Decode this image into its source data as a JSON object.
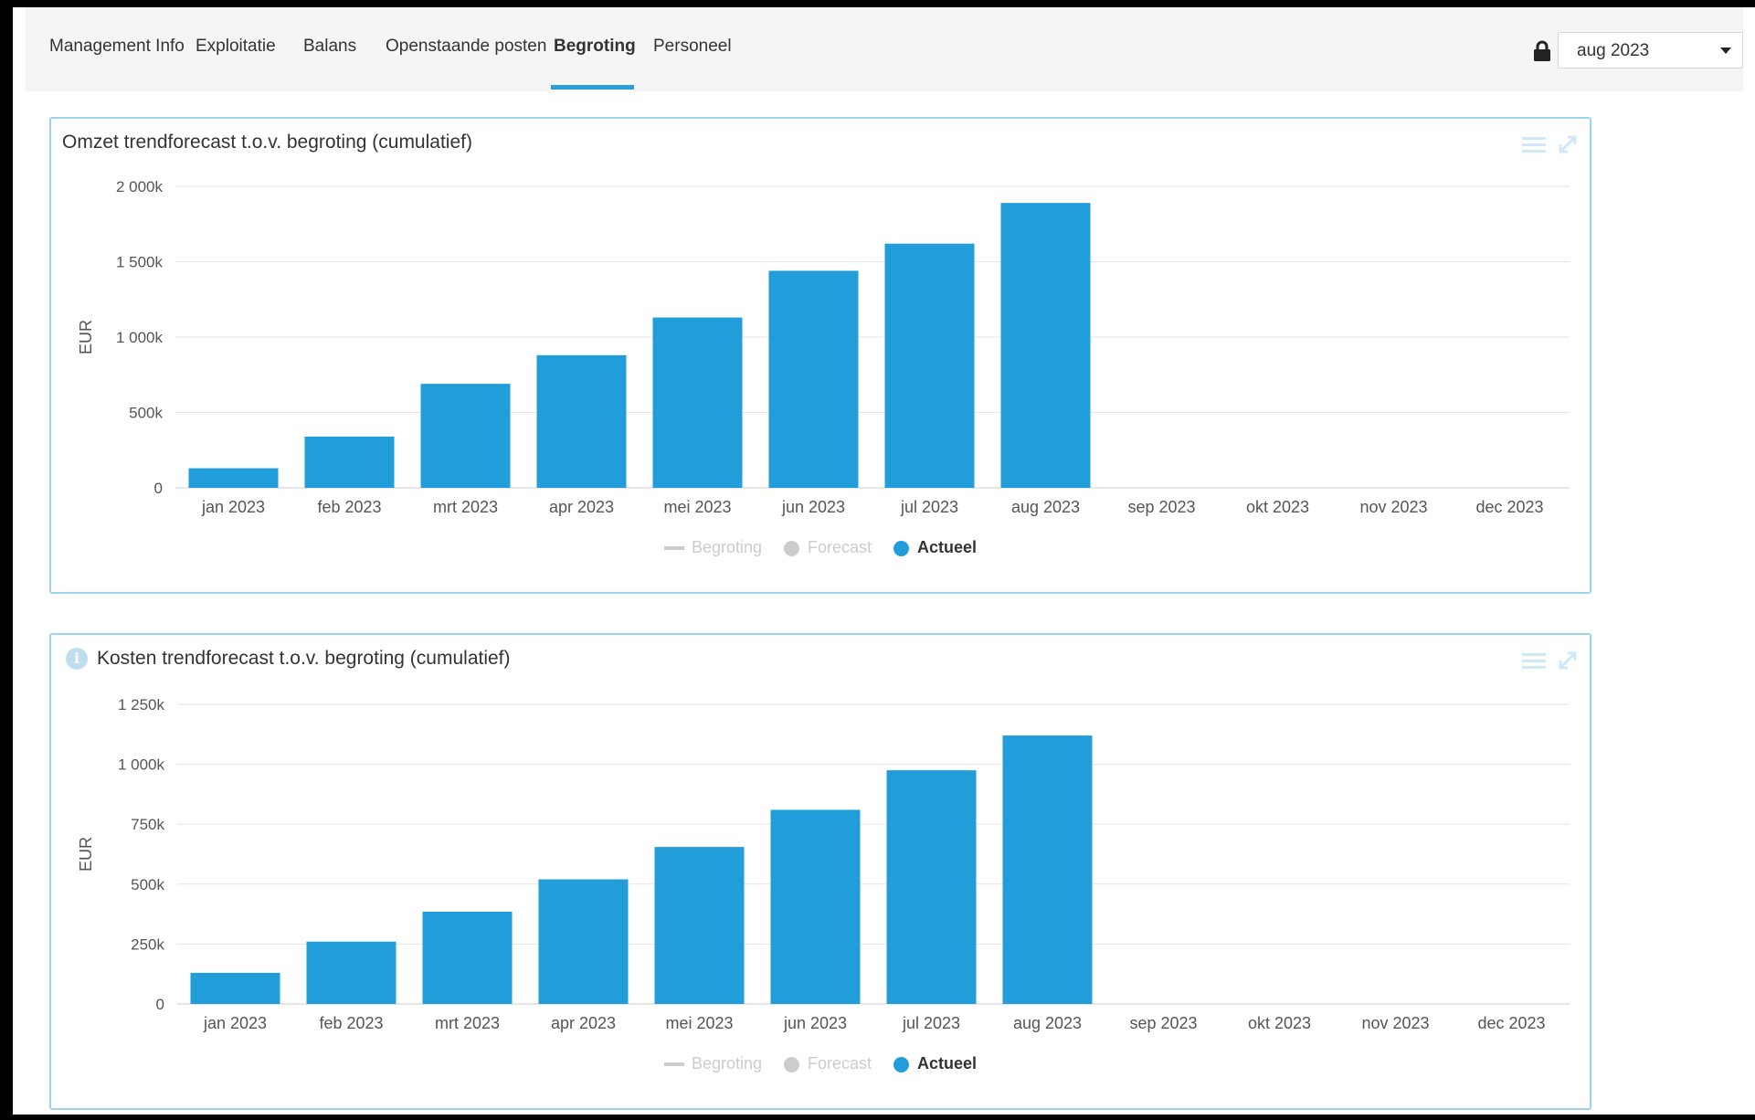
{
  "nav": {
    "tabs": [
      {
        "label": "Management Info"
      },
      {
        "label": "Exploitatie"
      },
      {
        "label": "Balans"
      },
      {
        "label": "Openstaande posten"
      },
      {
        "label": "Begroting"
      },
      {
        "label": "Personeel"
      }
    ],
    "active_tab": "Begroting",
    "lock_icon": "lock-icon",
    "period": "aug 2023"
  },
  "colors": {
    "accent": "#2a9fd8",
    "bar": "#219ed9",
    "panel_border": "#9dd3ee",
    "legend_inactive": "#cccccc"
  },
  "chart_data": [
    {
      "type": "bar",
      "title": "Omzet trendforecast t.o.v. begroting (cumulatief)",
      "ylabel": "EUR",
      "xlabel": "",
      "ylim": [
        0,
        2000
      ],
      "yticks": [
        0,
        500,
        1000,
        1500,
        2000
      ],
      "ytick_labels": [
        "0",
        "500k",
        "1 000k",
        "1 500k",
        "2 000k"
      ],
      "categories": [
        "jan 2023",
        "feb 2023",
        "mrt 2023",
        "apr 2023",
        "mei 2023",
        "jun 2023",
        "jul 2023",
        "aug 2023",
        "sep 2023",
        "okt 2023",
        "nov 2023",
        "dec 2023"
      ],
      "series": [
        {
          "name": "Actueel",
          "values": [
            130,
            340,
            690,
            880,
            1130,
            1440,
            1620,
            1890,
            null,
            null,
            null,
            null
          ]
        }
      ],
      "legend": [
        {
          "name": "Begroting",
          "symbol": "line",
          "active": false
        },
        {
          "name": "Forecast",
          "symbol": "dot",
          "active": false
        },
        {
          "name": "Actueel",
          "symbol": "dot",
          "active": true
        }
      ],
      "grid": true,
      "legend_position": "bottom"
    },
    {
      "type": "bar",
      "title": "Kosten trendforecast t.o.v. begroting (cumulatief)",
      "ylabel": "EUR",
      "xlabel": "",
      "ylim": [
        0,
        1250
      ],
      "yticks": [
        0,
        250,
        500,
        750,
        1000,
        1250
      ],
      "ytick_labels": [
        "0",
        "250k",
        "500k",
        "750k",
        "1 000k",
        "1 250k"
      ],
      "categories": [
        "jan 2023",
        "feb 2023",
        "mrt 2023",
        "apr 2023",
        "mei 2023",
        "jun 2023",
        "jul 2023",
        "aug 2023",
        "sep 2023",
        "okt 2023",
        "nov 2023",
        "dec 2023"
      ],
      "series": [
        {
          "name": "Actueel",
          "values": [
            130,
            260,
            385,
            520,
            655,
            810,
            975,
            1120,
            null,
            null,
            null,
            null
          ]
        }
      ],
      "legend": [
        {
          "name": "Begroting",
          "symbol": "line",
          "active": false
        },
        {
          "name": "Forecast",
          "symbol": "dot",
          "active": false
        },
        {
          "name": "Actueel",
          "symbol": "dot",
          "active": true
        }
      ],
      "grid": true,
      "legend_position": "bottom"
    }
  ]
}
